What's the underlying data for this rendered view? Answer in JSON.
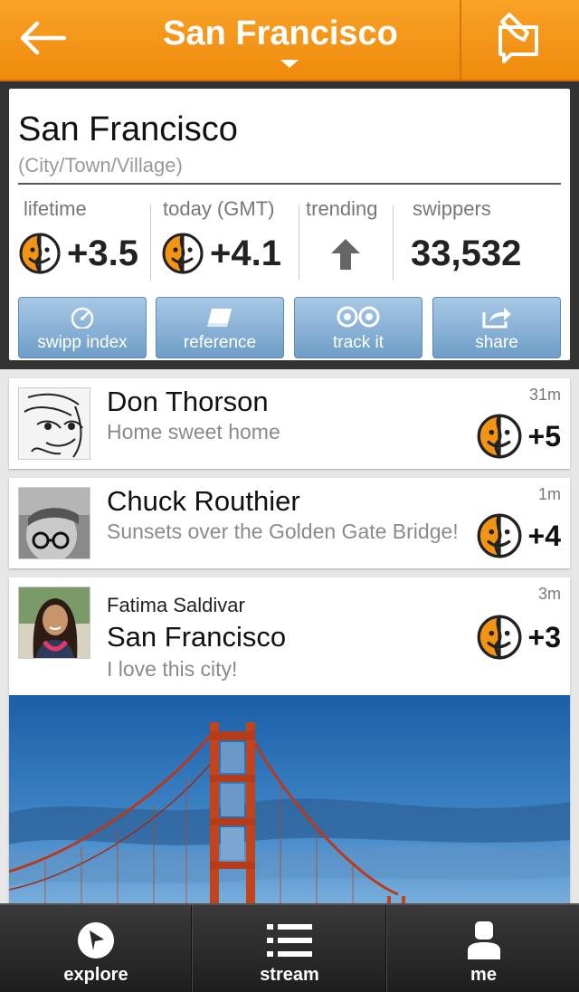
{
  "header": {
    "title": "San Francisco",
    "back_icon": "arrow-left-icon",
    "compose_icon": "compose-icon"
  },
  "place": {
    "name": "San Francisco",
    "type": "(City/Town/Village)"
  },
  "stats": {
    "lifetime": {
      "label": "lifetime",
      "value": "+3.5"
    },
    "today": {
      "label": "today (GMT)",
      "value": "+4.1"
    },
    "trending": {
      "label": "trending",
      "icon": "arrow-up-icon"
    },
    "swippers": {
      "label": "swippers",
      "value": "33,532"
    }
  },
  "actions": [
    {
      "label": "swipp index",
      "icon": "gauge-icon"
    },
    {
      "label": "reference",
      "icon": "book-icon"
    },
    {
      "label": "track it",
      "icon": "binoculars-icon"
    },
    {
      "label": "share",
      "icon": "share-icon"
    }
  ],
  "feed": [
    {
      "name": "Don Thorson",
      "text": "Home sweet home",
      "time": "31m",
      "score": "+5"
    },
    {
      "name": "Chuck Routhier",
      "text": "Sunsets over the Golden Gate Bridge!",
      "time": "1m",
      "score": "+4"
    },
    {
      "user": "Fatima Saldivar",
      "place": "San Francisco",
      "text": "I love this city!",
      "time": "3m",
      "score": "+3"
    }
  ],
  "tabs": [
    {
      "label": "explore",
      "icon": "compass-icon"
    },
    {
      "label": "stream",
      "icon": "list-icon"
    },
    {
      "label": "me",
      "icon": "person-icon"
    }
  ],
  "colors": {
    "brand_orange": "#f39514",
    "button_blue": "#7ba8d0",
    "tabbar": "#2a2a2a"
  }
}
